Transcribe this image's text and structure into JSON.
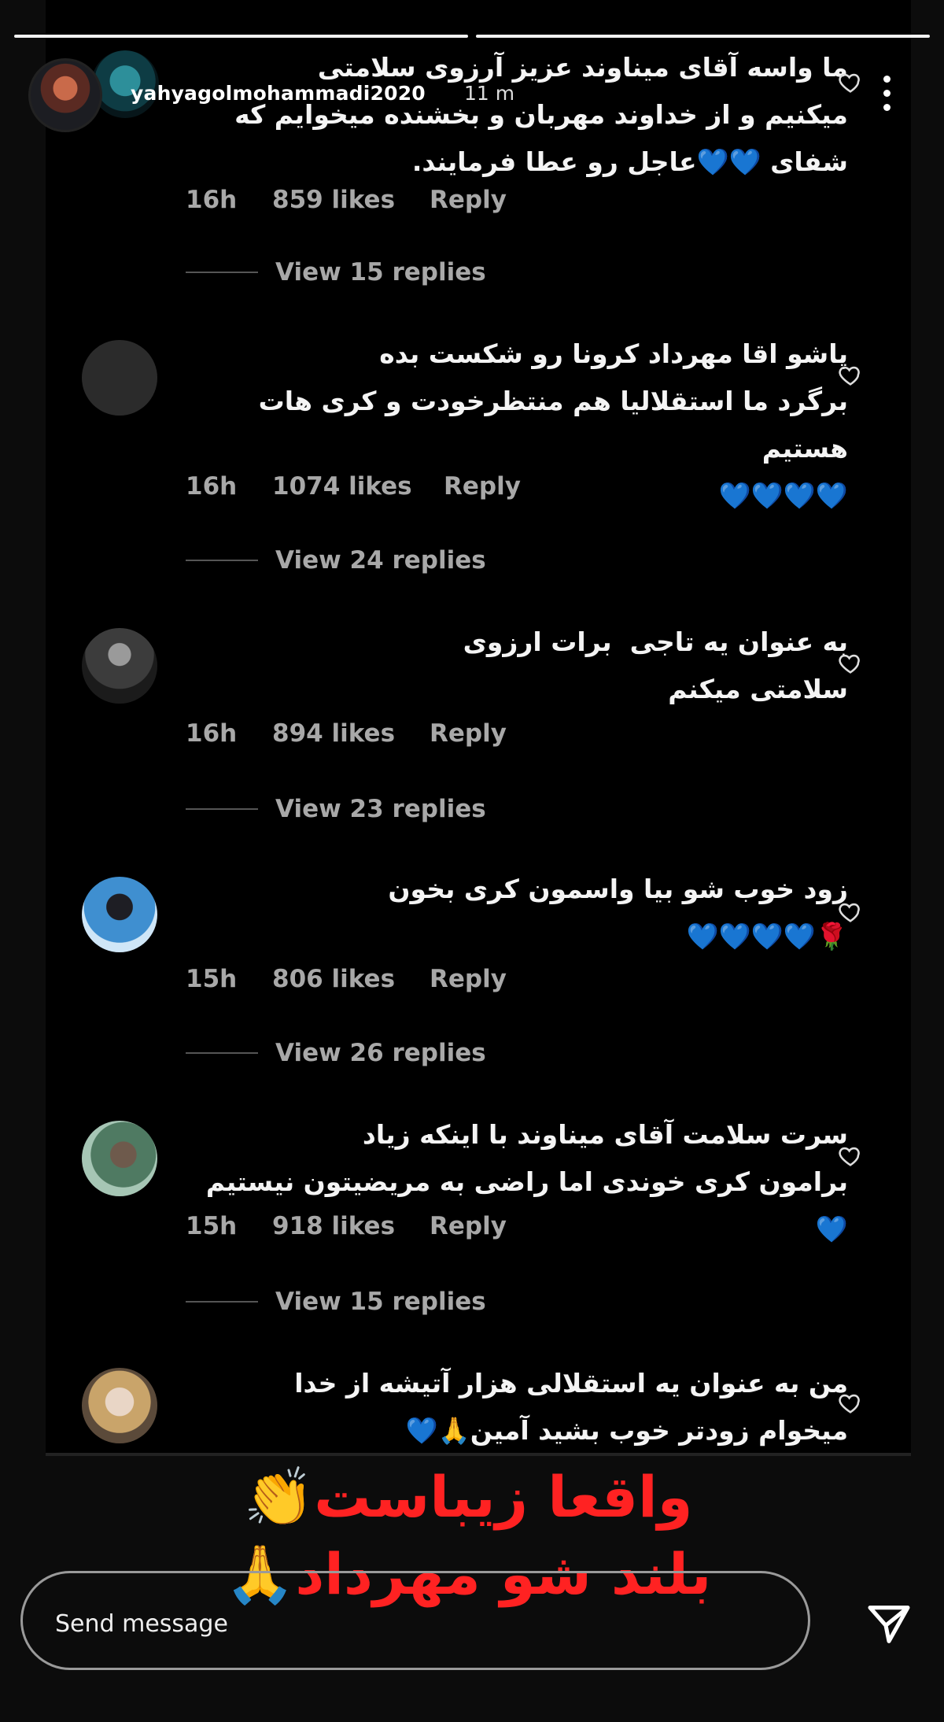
{
  "header": {
    "username": "yahyagolmohammadi2020",
    "time": "11 m"
  },
  "comments": [
    {
      "text": "ما واسه آقای میناوند عزیز آرزوی سلامتی\nمیکنیم و از خداوند مهربان و بخشنده میخوایم که\nشفای 💙💙عاجل رو عطا فرمایند.",
      "time": "16h",
      "likes": "859 likes",
      "reply": "Reply",
      "view_replies": "View 15 replies",
      "avatar": "none"
    },
    {
      "text": "پاشو اقا مهرداد کرونا رو شکست بده\nبرگرد ما استقلالیا هم منتظرخودت و کری هات هستیم\n💙💙💙💙",
      "time": "16h",
      "likes": "1074 likes",
      "reply": "Reply",
      "view_replies": "View 24 replies",
      "avatar": "grey"
    },
    {
      "text": "به عنوان یه تاجی  برات ارزوی\nسلامتی میکنم",
      "time": "16h",
      "likes": "894 likes",
      "reply": "Reply",
      "view_replies": "View 23 replies",
      "avatar": "photo"
    },
    {
      "text": "زود خوب شو بیا واسمون کری بخون\n🌹💙💙💙💙",
      "time": "15h",
      "likes": "806 likes",
      "reply": "Reply",
      "view_replies": "View 26 replies",
      "avatar": "photo"
    },
    {
      "text": "سرت سلامت آقای میناوند با اینکه زیاد\nبرامون کری خوندی اما راضی به مریضیتون نیستیم💙",
      "time": "15h",
      "likes": "918 likes",
      "reply": "Reply",
      "view_replies": "View 15 replies",
      "avatar": "photo"
    },
    {
      "text": "من به عنوان یه استقلالی هزار آتیشه از خدا\nمیخوام زودتر خوب بشید آمین🙏💙",
      "avatar": "photo"
    }
  ],
  "overlay": {
    "line1": "واقعا زیباست",
    "line1_emoji": "👏",
    "line2": "بلند شو مهرداد",
    "line2_emoji": "🙏"
  },
  "send_bar": {
    "placeholder": "Send message"
  },
  "colors": {
    "background": "#000000",
    "meta_text": "#a8a8a8",
    "caption_red": "#ff2222"
  }
}
